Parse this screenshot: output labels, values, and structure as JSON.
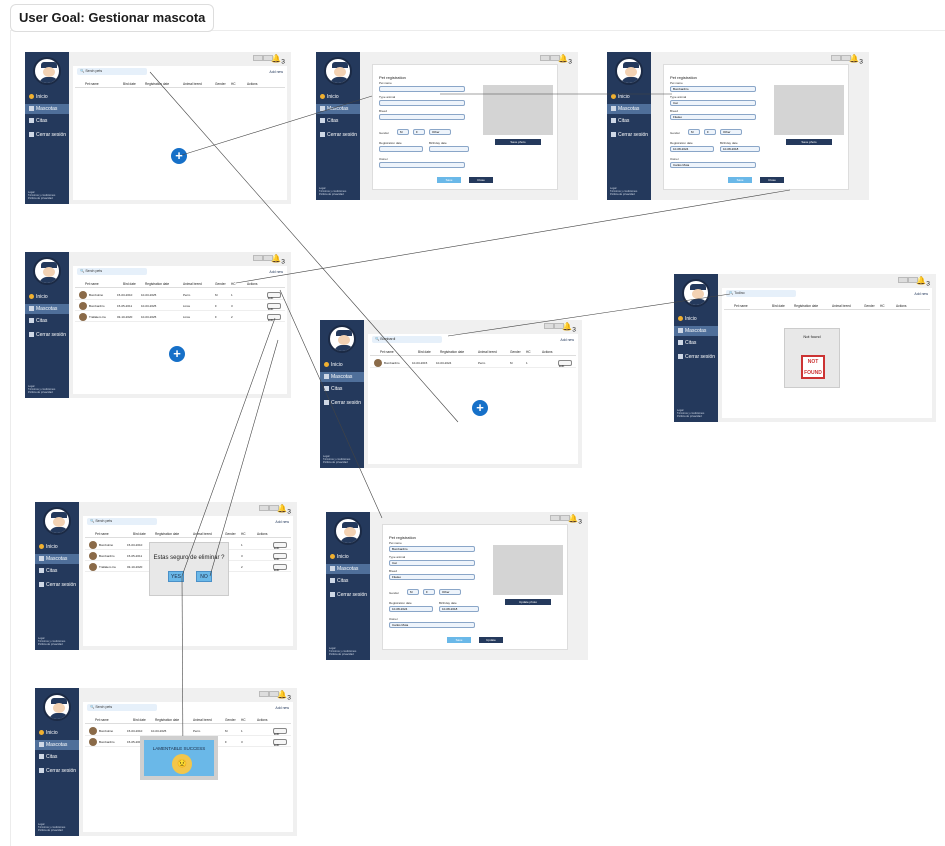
{
  "goal_title": "User Goal: Gestionar mascota",
  "sidebar": {
    "inicio": "Inicio",
    "mascotas": "Mascotas",
    "citas": "Citas",
    "cerrar": "Cerrar sesión",
    "legal": "Legal",
    "legal_sub1": "Términos y condiciones",
    "legal_sub2": "Política de privacidad"
  },
  "list": {
    "search_placeholder": "Serch pets",
    "add_new": "Add new",
    "columns": [
      "Pet name",
      "Bird date",
      "Registration date",
      "Animal breed",
      "Gender",
      "HC",
      "Actions"
    ],
    "rows": [
      {
        "name": "Bombolino",
        "bird": "15-03-2010",
        "reg": "10-03-2025",
        "breed": "Perro",
        "gender": "M",
        "hc": "1",
        "action": "Edit"
      },
      {
        "name": "Bombardiro",
        "bird": "15-05-2011",
        "reg": "10-03-2025",
        "breed": "Lince",
        "gender": "F",
        "hc": "3",
        "action": "Edit"
      },
      {
        "name": "Trallalero tra",
        "bird": "03-10-2020",
        "reg": "10-03-2025",
        "breed": "Lince",
        "gender": "F",
        "hc": "2",
        "action": "Edit"
      }
    ]
  },
  "filtered": {
    "search": "Bombardi",
    "row": {
      "name": "Bombardiro",
      "bird": "10-03-2015",
      "reg": "10-03-2024",
      "breed": "Perro",
      "gender": "M",
      "hc": "1",
      "action": "Edit"
    }
  },
  "notfound": {
    "search": "Todino",
    "title": "Not found",
    "badge": "NOT FOUND"
  },
  "form": {
    "title": "Pet registration",
    "pet_name_label": "Pet name",
    "type_label": "Type animal",
    "breed_label": "Breed",
    "gender_label": "Gender",
    "gender_m": "M",
    "gender_f": "F",
    "gender_other": "Other",
    "reg_label": "Registration date",
    "birth_label": "Birthday date",
    "owner_label": "Owner",
    "save_photo": "Save photo",
    "update_photo": "Update photo",
    "save": "Save",
    "close": "Close",
    "update": "Update",
    "filled_name": "Bombardiro",
    "filled_type": "Cat",
    "filled_breed": "Fiteleo",
    "filled_reg": "10-08-2024",
    "filled_birth": "10-08-2018",
    "filled_owner": "Carlos Mota"
  },
  "delete_dialog": {
    "question": "Estas seguro de eliminar ?",
    "yes": "YES",
    "no": "NO"
  },
  "success": {
    "text": "LAMENTABLE SUCCESS"
  },
  "bell_count": "3"
}
